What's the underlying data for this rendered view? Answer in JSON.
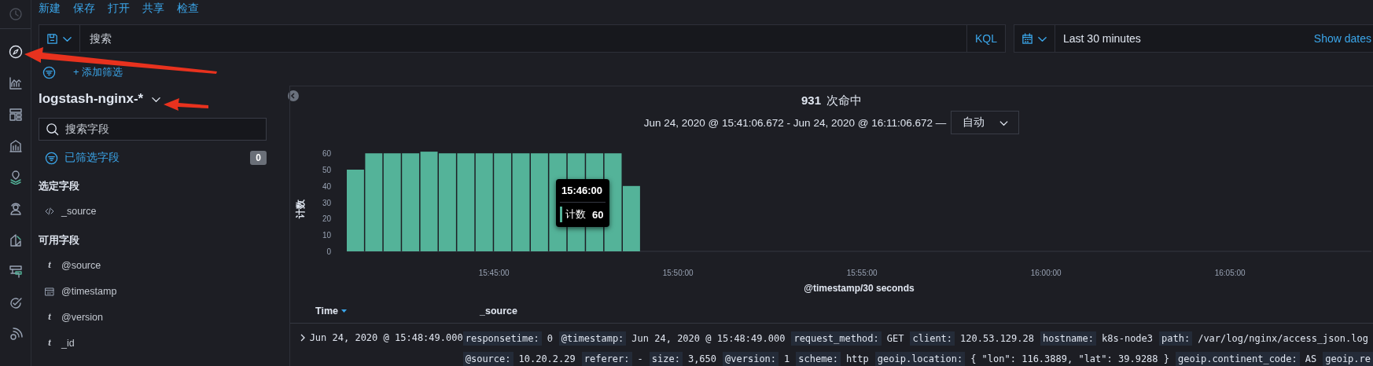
{
  "menu": [
    "新建",
    "保存",
    "打开",
    "共享",
    "检查"
  ],
  "query_bar": {
    "placeholder": "搜索",
    "language": "KQL"
  },
  "date_picker": {
    "value": "Last 30 minutes",
    "show_dates": "Show dates"
  },
  "filter_bar": {
    "add_filter": "+ 添加筛选"
  },
  "sidebar": {
    "index_pattern": "logstash-nginx-*",
    "search": {
      "placeholder": "搜索字段"
    },
    "filtered_fields": {
      "label": "已筛选字段",
      "count": "0"
    },
    "sections": [
      {
        "title": "选定字段",
        "fields": [
          {
            "kind": "source",
            "name": "_source"
          }
        ]
      },
      {
        "title": "可用字段",
        "fields": [
          {
            "kind": "string",
            "glyph": "t",
            "name": "@source"
          },
          {
            "kind": "date",
            "name": "@timestamp"
          },
          {
            "kind": "string",
            "glyph": "t",
            "name": "@version"
          },
          {
            "kind": "string",
            "glyph": "t",
            "name": "_id"
          }
        ]
      }
    ]
  },
  "hits": {
    "count": "931",
    "label": "次命中"
  },
  "time_range": "Jun 24, 2020 @ 15:41:06.672 - Jun 24, 2020 @ 16:11:06.672 —",
  "interval": "自动",
  "chart_data": {
    "type": "bar",
    "xlabel": "@timestamp/30 seconds",
    "ylabel": "计数",
    "categories": [
      null,
      null,
      null,
      null,
      null,
      null,
      null,
      null,
      "15:45:00",
      null,
      null,
      null,
      null,
      null,
      null,
      null,
      null,
      null,
      "15:50:00",
      null,
      null,
      null,
      null,
      null,
      null,
      null,
      null,
      null,
      "15:55:00",
      null,
      null,
      null,
      null,
      null,
      null,
      null,
      null,
      null,
      "16:00:00",
      null,
      null,
      null,
      null,
      null,
      null,
      null,
      null,
      null,
      "16:05:00",
      null,
      null,
      null,
      null,
      null,
      null
    ],
    "values": [
      50,
      60,
      60,
      60,
      61,
      60,
      60,
      60,
      60,
      60,
      60,
      60,
      60,
      60,
      60,
      40,
      null,
      null,
      null,
      null,
      null,
      null,
      null,
      null,
      null,
      null,
      null,
      null,
      null,
      null,
      null,
      null,
      null,
      null,
      null,
      null,
      null,
      null,
      null,
      null,
      null,
      null,
      null,
      null,
      null,
      null,
      null,
      null,
      null,
      null,
      null,
      null,
      null,
      null,
      null
    ],
    "ylim": [
      0,
      62
    ],
    "yticks": [
      0,
      10,
      20,
      30,
      40,
      50,
      60
    ]
  },
  "tooltip": {
    "title": "15:46:00",
    "label": "计数",
    "value": "60"
  },
  "table": {
    "columns": [
      {
        "label": "Time",
        "sorted": true
      },
      {
        "label": "_source",
        "sorted": false
      }
    ],
    "rows": [
      {
        "expanded": false,
        "time": "Jun 24, 2020 @ 15:48:49.000",
        "source_lines": [
          [
            {
              "key": "responsetime:",
              "value": "0"
            },
            {
              "key": "@timestamp:",
              "value": "Jun 24, 2020 @ 15:48:49.000"
            },
            {
              "key": "request_method:",
              "value": "GET"
            },
            {
              "key": "client:",
              "value": "120.53.129.28"
            },
            {
              "key": "hostname:",
              "value": "k8s-node3"
            },
            {
              "key": "path:",
              "value": "/var/log/nginx/access_json.log"
            }
          ],
          [
            {
              "key": "@source:",
              "value": "10.20.2.29"
            },
            {
              "key": "referer:",
              "value": "-"
            },
            {
              "key": "size:",
              "value": "3,650"
            },
            {
              "key": "@version:",
              "value": "1"
            },
            {
              "key": "scheme:",
              "value": "http"
            },
            {
              "key": "geoip.location:",
              "value": "{ \"lon\": 116.3889, \"lat\": 39.9288 }"
            },
            {
              "key": "geoip.continent_code:",
              "value": "AS"
            },
            {
              "key": "geoip.re"
            }
          ]
        ]
      }
    ]
  }
}
